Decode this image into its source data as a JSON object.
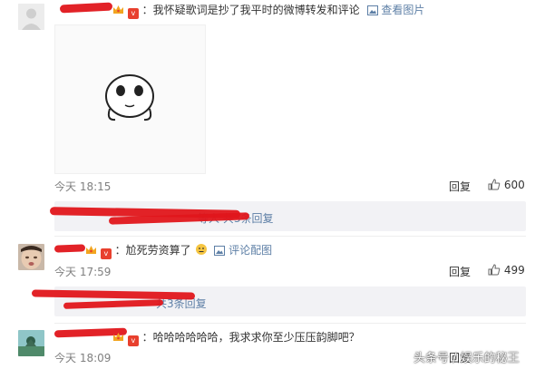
{
  "comments": [
    {
      "text_prefix": "：",
      "text": "我怀疑歌词是抄了我平时的微博转发和评论",
      "media_link": "查看图片",
      "time": "今天 18:15",
      "reply_label": "回复",
      "likes": "600"
    },
    {
      "text_prefix": "：",
      "text": "尬死劳资算了",
      "media_link": "评论配图",
      "time": "今天 17:59",
      "reply_label": "回复",
      "likes": "499"
    },
    {
      "text_prefix": "：",
      "text": "哈哈哈哈哈哈，我求求你至少压压韵脚吧？",
      "time": "今天 18:09",
      "reply_label": "回复"
    }
  ],
  "replies_bar_1": {
    "text": "等人 共3条回复"
  },
  "replies_bar_2": {
    "text": "共3条回复"
  },
  "watermark": "头条号 / 娱乐的秘王",
  "colors": {
    "scribble": "#e0161b",
    "link": "#5d7fa6",
    "bar": "#f2f2f5"
  }
}
